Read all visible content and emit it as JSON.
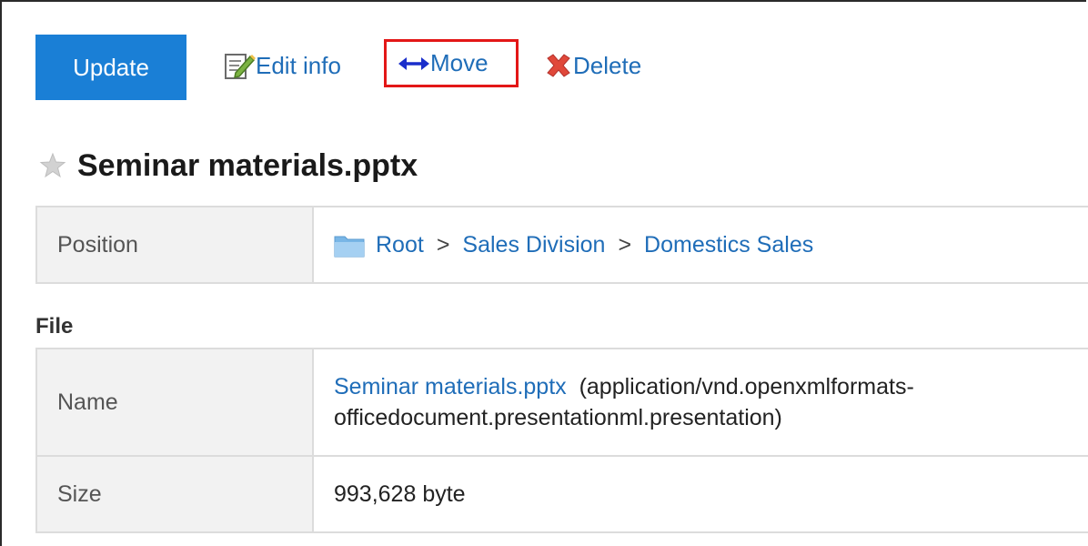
{
  "toolbar": {
    "update_label": "Update",
    "edit_label": "Edit info",
    "move_label": "Move",
    "delete_label": "Delete"
  },
  "file_title": "Seminar materials.pptx",
  "position": {
    "label": "Position",
    "breadcrumbs": [
      "Root",
      "Sales Division",
      "Domestics Sales"
    ],
    "separator": ">"
  },
  "file_section": {
    "heading": "File",
    "name_label": "Name",
    "name_value": "Seminar materials.pptx",
    "mime_type": "(application/vnd.openxmlformats-officedocument.presentationml.presentation)",
    "size_label": "Size",
    "size_value": "993,628 byte"
  },
  "icons": {
    "edit": "edit-icon",
    "move": "move-arrows-icon",
    "delete": "delete-x-icon",
    "star": "star-icon",
    "folder": "folder-icon"
  },
  "colors": {
    "accent": "#1a7fd6",
    "link": "#1f6db8",
    "highlight_box": "#e31717",
    "delete_icon": "#e0483a",
    "label_bg": "#f2f2f2"
  }
}
